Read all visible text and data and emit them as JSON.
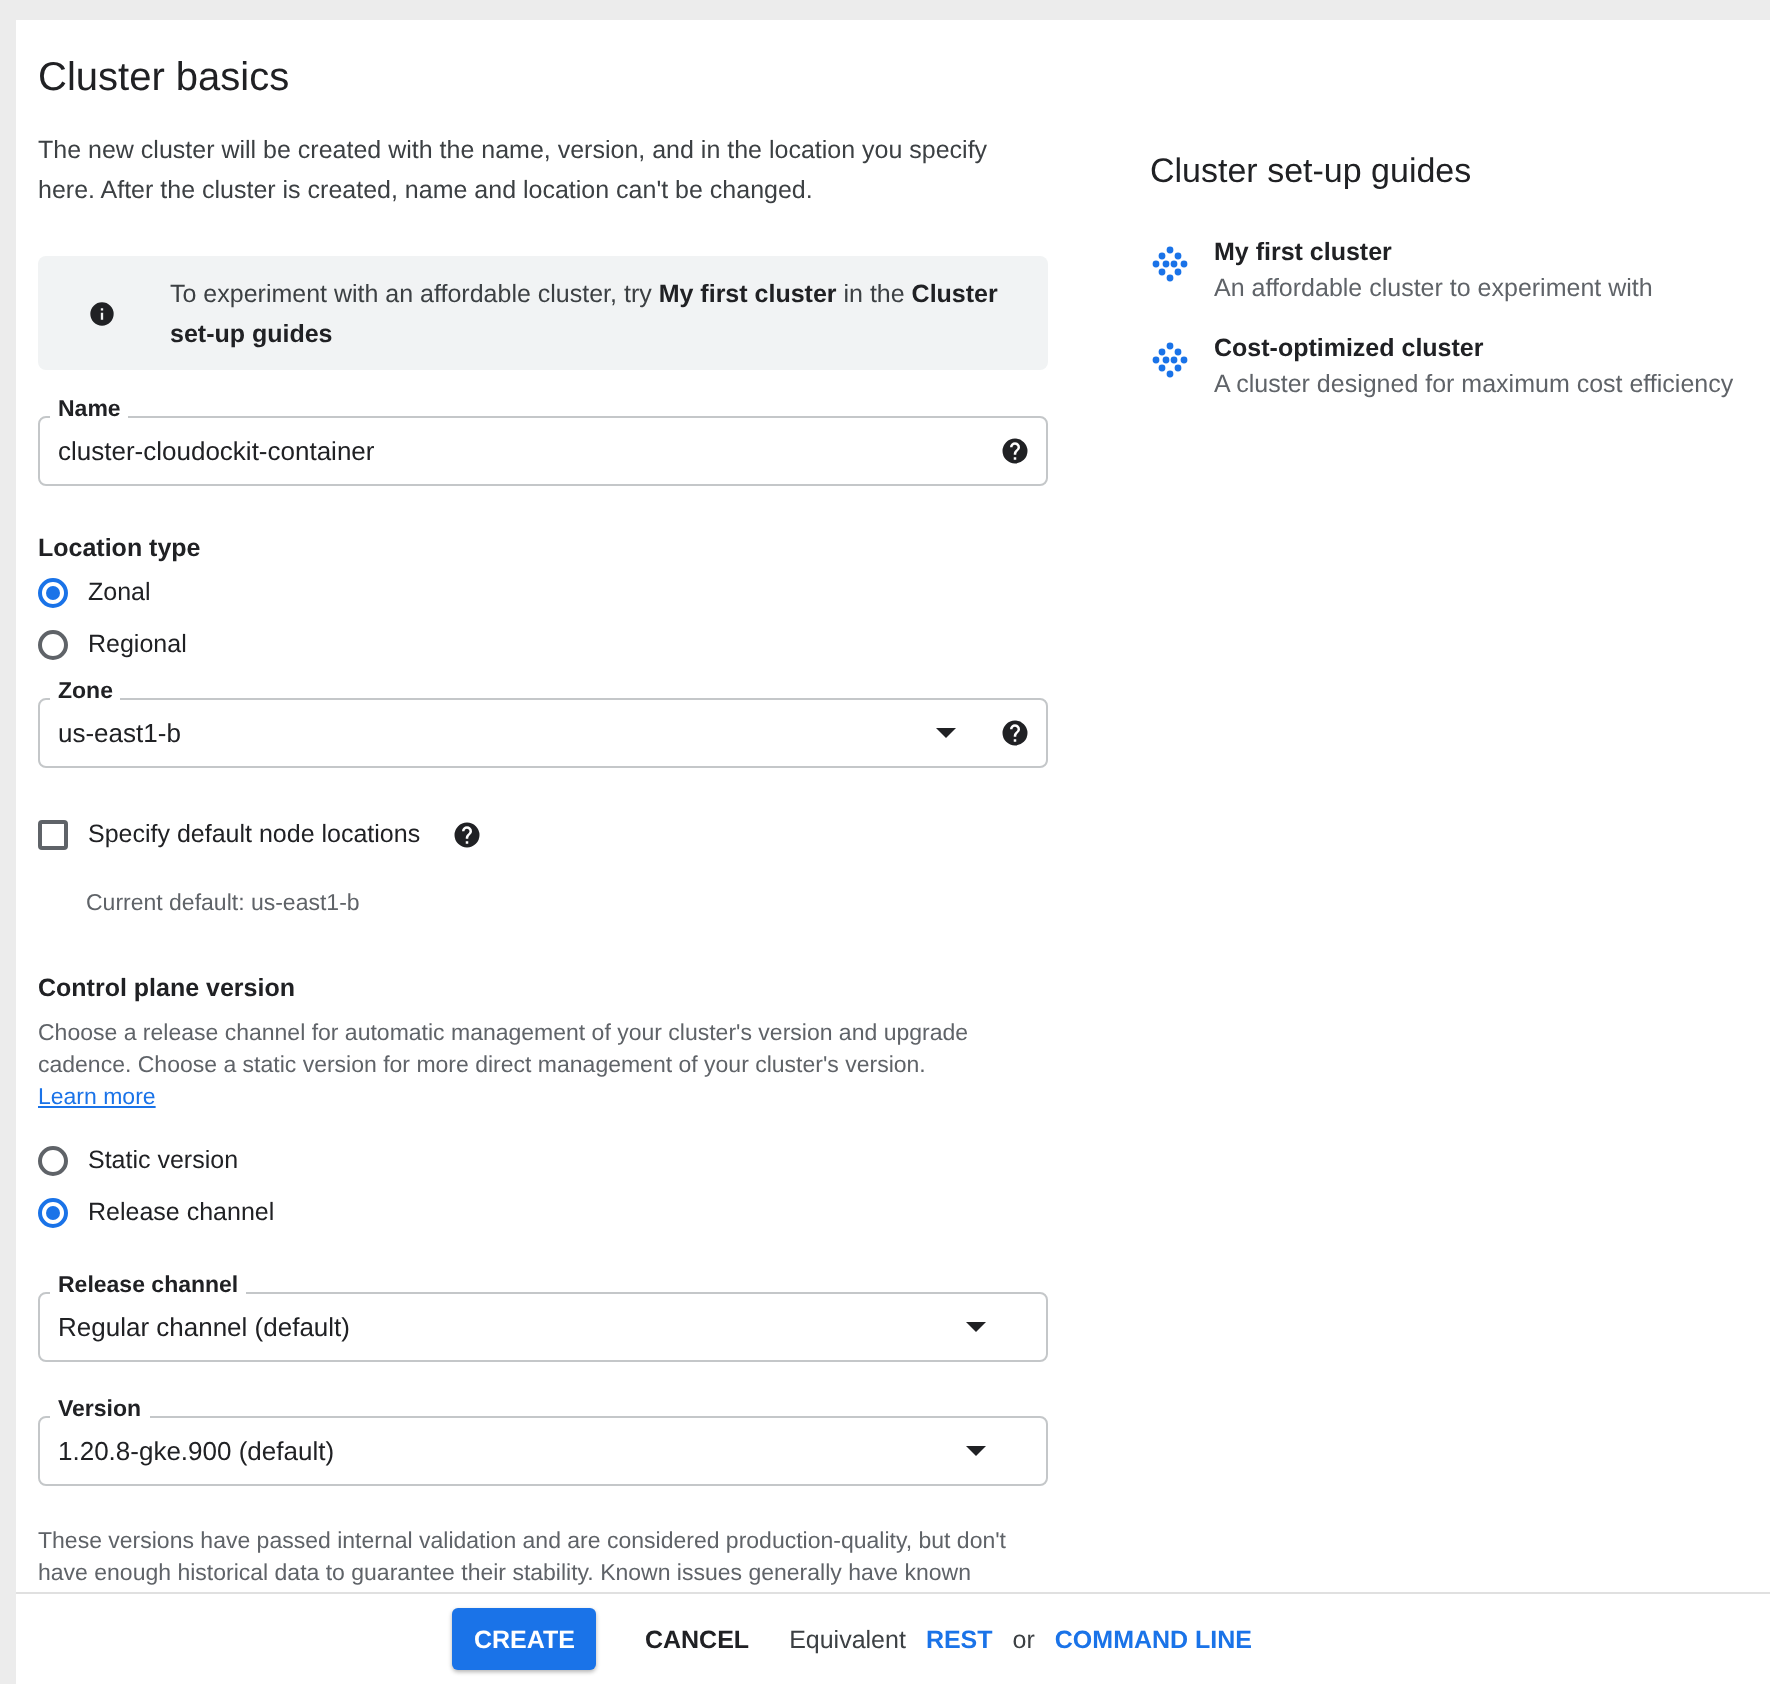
{
  "title": "Cluster basics",
  "description": "The new cluster will be created with the name, version, and in the location you specify here. After the cluster is created, name and location can't be changed.",
  "info_banner": "To experiment with an affordable cluster, try **My first cluster** in the **Cluster set-up guides**",
  "name_field": {
    "label": "Name",
    "value": "cluster-cloudockit-container",
    "dropdown": false,
    "help": true
  },
  "location_type": {
    "heading": "Location type",
    "options": [
      {
        "label": "Zonal",
        "selected": true
      },
      {
        "label": "Regional",
        "selected": false
      }
    ]
  },
  "zone_field": {
    "label": "Zone",
    "value": "us-east1-b",
    "dropdown": true,
    "help": true
  },
  "default_node_locations": {
    "label": "Specify default node locations",
    "checked": false,
    "help": true,
    "hint": "Current default: us-east1-b"
  },
  "control_plane": {
    "heading": "Control plane version",
    "description": "Choose a release channel for automatic management of your cluster's version and upgrade cadence. Choose a static version for more direct management of your cluster's version.",
    "link": "Learn more",
    "options": [
      {
        "label": "Static version",
        "selected": false
      },
      {
        "label": "Release channel",
        "selected": true
      }
    ]
  },
  "release_channel_field": {
    "label": "Release channel",
    "value": "Regular channel (default)",
    "dropdown": true,
    "help": false
  },
  "version_field": {
    "label": "Version",
    "value": "1.20.8-gke.900 (default)",
    "dropdown": true,
    "help": false
  },
  "version_note": "These versions have passed internal validation and are considered production-quality, but don't have enough historical data to guarantee their stability. Known issues generally have known",
  "guides": {
    "title": "Cluster set-up guides",
    "items": [
      {
        "name": "My first cluster",
        "description": "An affordable cluster to experiment with"
      },
      {
        "name": "Cost-optimized cluster",
        "description": "A cluster designed for maximum cost efficiency"
      }
    ]
  },
  "footer": {
    "create": "CREATE",
    "cancel": "CANCEL",
    "equivalent": "Equivalent",
    "rest": "REST",
    "or": "or",
    "command_line": "COMMAND LINE"
  }
}
